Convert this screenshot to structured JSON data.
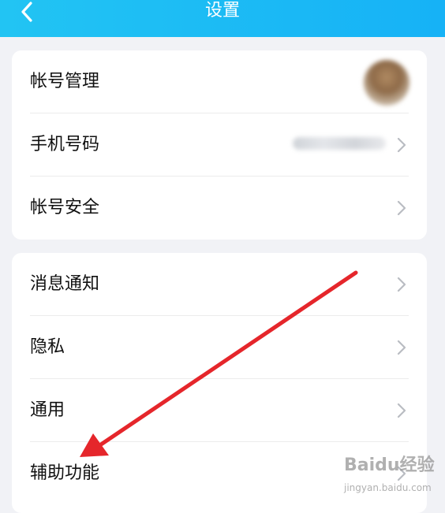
{
  "header": {
    "title": "设置",
    "back_icon": "chevron-left-icon",
    "color": "#1fbef4"
  },
  "account_group": [
    {
      "label": "帐号管理",
      "trailing": "avatar"
    },
    {
      "label": "手机号码",
      "trailing": "chevron-right-icon"
    },
    {
      "label": "帐号安全",
      "trailing": "chevron-right-icon"
    }
  ],
  "general_group": [
    {
      "label": "消息通知",
      "trailing": "chevron-right-icon"
    },
    {
      "label": "隐私",
      "trailing": "chevron-right-icon"
    },
    {
      "label": "通用",
      "trailing": "chevron-right-icon"
    },
    {
      "label": "辅助功能",
      "trailing": "chevron-right-icon"
    }
  ],
  "annotation": {
    "color": "#e5262b"
  },
  "watermark": {
    "main": "Baidu经验",
    "sub": "jingyan.baidu.com"
  }
}
